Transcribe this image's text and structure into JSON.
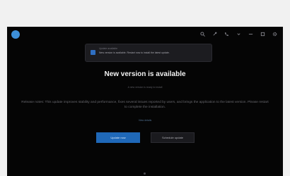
{
  "notification": {
    "title": "Update available",
    "message": "New version is available. Restart now to install the latest update."
  },
  "dialog": {
    "title": "New version is available",
    "subtitle": "A new version is ready to install",
    "body": "Release notes: This update improves stability and performance, fixes several issues reported by users, and brings the application to the latest version. Please restart to complete the installation.",
    "link": "View details",
    "primary_button": "Update now",
    "secondary_button": "Schedule update"
  },
  "colors": {
    "accent": "#1f68b8",
    "background": "#050505",
    "page": "#f1f1f1"
  },
  "topbar": {
    "icons": [
      "search-icon",
      "pin-icon",
      "phone-icon",
      "chevron-down-icon",
      "minimize-icon",
      "maximize-icon",
      "settings-icon"
    ]
  }
}
